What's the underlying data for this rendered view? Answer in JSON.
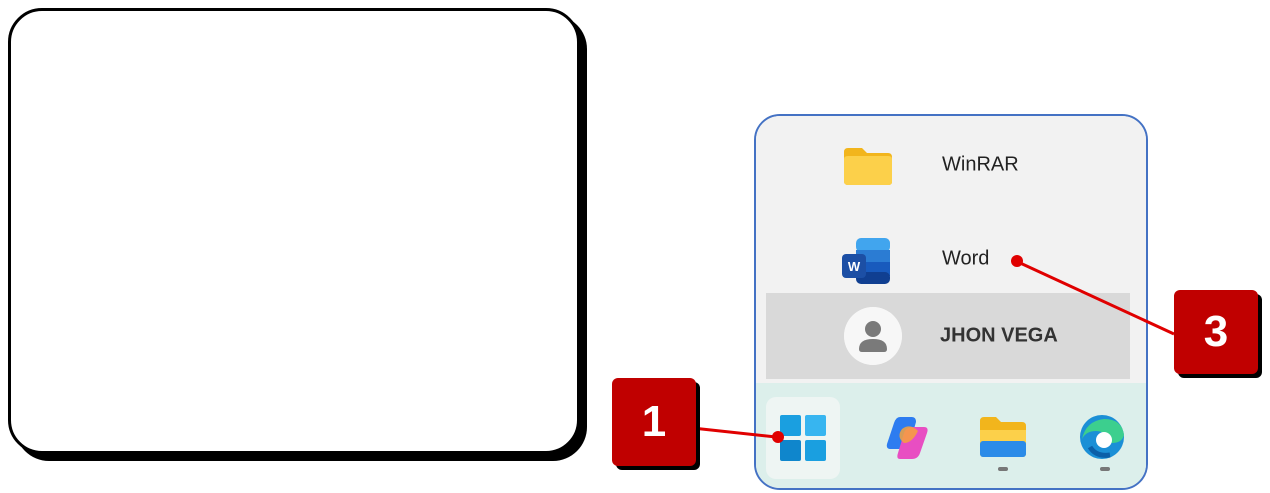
{
  "start_menu": {
    "items": [
      {
        "label": "WinRAR",
        "icon": "folder-icon"
      },
      {
        "label": "Word",
        "icon": "word-icon"
      }
    ],
    "account": {
      "name": "JHON VEGA",
      "icon": "user-avatar-icon"
    }
  },
  "taskbar": {
    "buttons": [
      {
        "name": "start",
        "icon": "windows-start-icon"
      },
      {
        "name": "copilot",
        "icon": "copilot-icon"
      },
      {
        "name": "file-explorer",
        "icon": "file-explorer-icon"
      },
      {
        "name": "edge",
        "icon": "edge-browser-icon"
      }
    ]
  },
  "callouts": {
    "first": "1",
    "third": "3"
  },
  "colors": {
    "callout": "#c00000",
    "frame_border": "#4472c4",
    "taskbar": "#dcefeb",
    "account_highlight": "#d9d9d9"
  }
}
